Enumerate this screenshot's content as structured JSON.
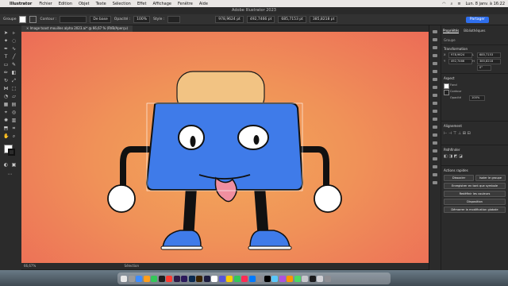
{
  "menubar": {
    "app_name": "Illustrator",
    "items": [
      "Fichier",
      "Edition",
      "Objet",
      "Texte",
      "Sélection",
      "Effet",
      "Affichage",
      "Fenêtre",
      "Aide"
    ],
    "datetime": "Lun. 8 janv. à 16:22"
  },
  "window": {
    "title": "Adobe Illustrator 2023"
  },
  "control_bar": {
    "object_type": "Groupe",
    "stroke_label": "Contour :",
    "stroke_style": "De base",
    "opacity_label": "Opacité :",
    "opacity_value": "100%",
    "style_label": "Style :",
    "x_value": "978,9624 pt",
    "y_value": "492,7466 pt",
    "w_value": "685,7153 pt",
    "h_value": "385,8218 pt",
    "share_label": "Partager"
  },
  "document": {
    "tab_label": "Image toast mouilles alpha 2023.ai* @ 66,67 % (RVB/Aperçu)",
    "zoom": "66,67%",
    "status_tool": "Sélection"
  },
  "panel": {
    "tabs": [
      "Propriétés",
      "Bibliothèques"
    ],
    "group_label": "Groupe",
    "transform_title": "Transformation",
    "x": "978,9624",
    "y": "492,7466",
    "w": "685,7153",
    "h": "385,8218",
    "angle": "0°",
    "appearance_title": "Aspect",
    "fill_label": "Fond",
    "stroke_label": "Contour",
    "opacity_label": "Opacité",
    "opacity_value": "100%",
    "align_title": "Alignement",
    "pathfinder_title": "Pathfinder",
    "quick_actions_title": "Actions rapides",
    "btn_ungroup": "Dissocier",
    "btn_isolate": "Isoler le groupe",
    "btn_save_symbol": "Enregistrer en tant que symbole",
    "btn_recolor": "Redéfinir les couleurs",
    "btn_arrange": "Disposition",
    "btn_start_global": "Démarrer la modification globale"
  },
  "colors": {
    "toast_blue": "#3f7be9",
    "crust": "#f2c383",
    "tongue": "#f08fa0",
    "shoe_blue": "#3f7be9",
    "bg_center": "#f3a85a",
    "bg_edge": "#ec6c57",
    "share_button": "#2f6fed"
  }
}
